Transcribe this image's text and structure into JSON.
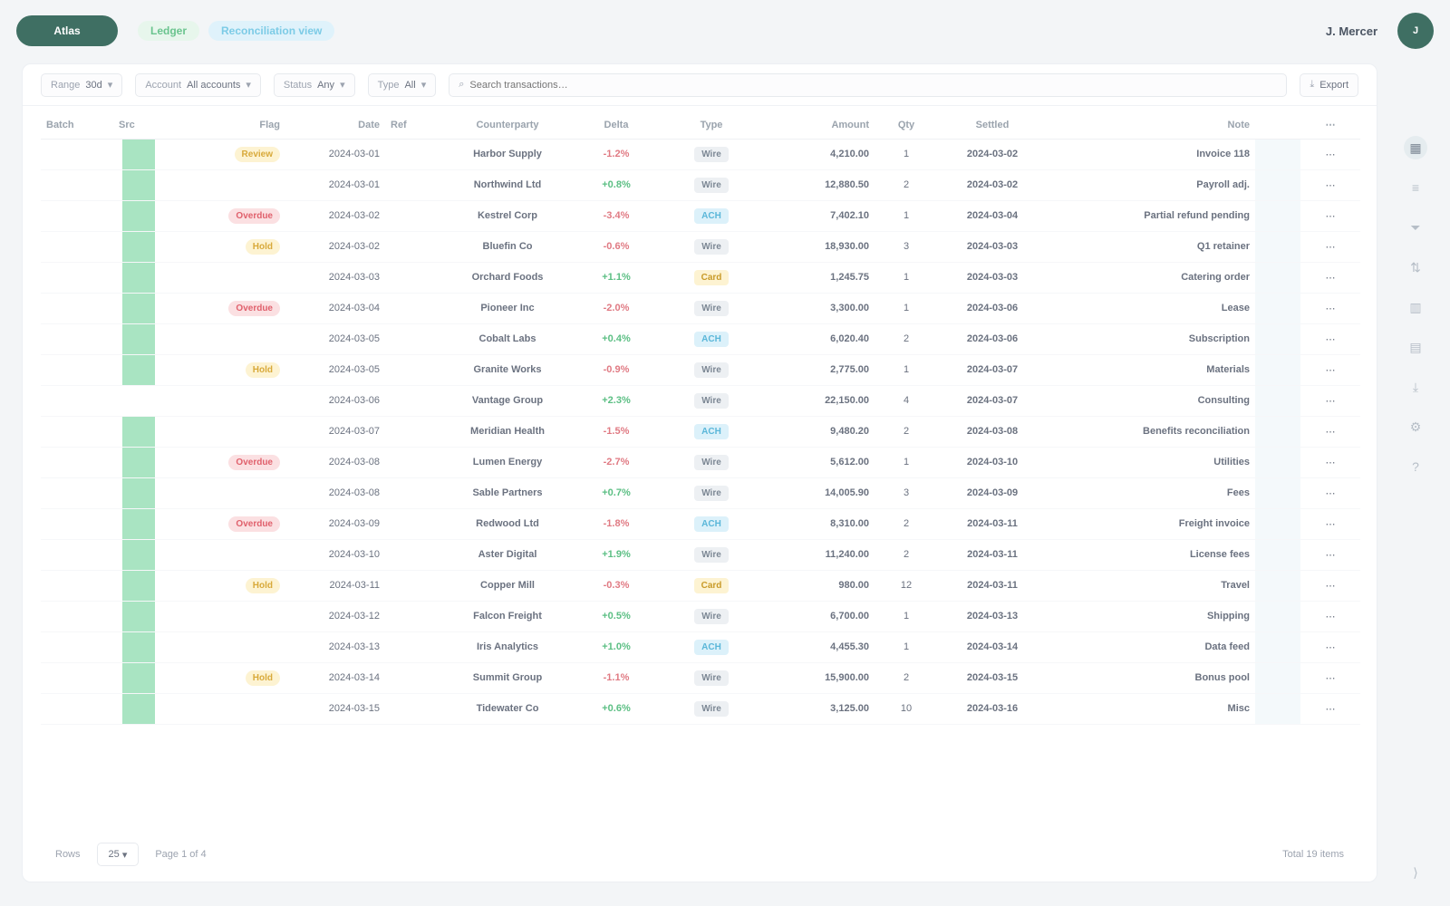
{
  "app": {
    "logo": "Atlas"
  },
  "breadcrumbs": [
    "Ledger",
    "Reconciliation view"
  ],
  "top": {
    "user": "J. Mercer",
    "avatar_initial": "J"
  },
  "filters": {
    "range_label": "Range",
    "range_value": "30d",
    "account_label": "Account",
    "account_value": "All accounts",
    "status_label": "Status",
    "status_value": "Any",
    "type_label": "Type",
    "type_value": "All",
    "search_placeholder": "Search transactions…",
    "export_label": "Export"
  },
  "table": {
    "columns": [
      "Batch",
      "Src",
      "Flag",
      "Date",
      "Ref",
      "Counterparty",
      "Delta",
      "Type",
      "Amount",
      "Qty",
      "Settled",
      "Note",
      "",
      "⋯"
    ],
    "rows": [
      {
        "flag": "Review",
        "flag_kind": "yellow",
        "date": "2024-03-01",
        "party": "Harbor Supply",
        "delta": "-1.2%",
        "delta_kind": "neg",
        "type": "Wire",
        "type_kind": "gray",
        "amount": "4,210.00",
        "qty": "1",
        "settled": "2024-03-02",
        "note": "Invoice 118"
      },
      {
        "flag": "",
        "flag_kind": "none",
        "date": "2024-03-01",
        "party": "Northwind Ltd",
        "delta": "+0.8%",
        "delta_kind": "pos",
        "type": "Wire",
        "type_kind": "gray",
        "amount": "12,880.50",
        "qty": "2",
        "settled": "2024-03-02",
        "note": "Payroll adj."
      },
      {
        "flag": "Overdue",
        "flag_kind": "red",
        "date": "2024-03-02",
        "party": "Kestrel Corp",
        "delta": "-3.4%",
        "delta_kind": "neg",
        "type": "ACH",
        "type_kind": "blue",
        "amount": "7,402.10",
        "qty": "1",
        "settled": "2024-03-04",
        "note": "Partial refund pending"
      },
      {
        "flag": "Hold",
        "flag_kind": "yellow",
        "date": "2024-03-02",
        "party": "Bluefin Co",
        "delta": "-0.6%",
        "delta_kind": "neg",
        "type": "Wire",
        "type_kind": "gray",
        "amount": "18,930.00",
        "qty": "3",
        "settled": "2024-03-03",
        "note": "Q1 retainer"
      },
      {
        "flag": "",
        "flag_kind": "none",
        "date": "2024-03-03",
        "party": "Orchard Foods",
        "delta": "+1.1%",
        "delta_kind": "pos",
        "type": "Card",
        "type_kind": "yellow",
        "amount": "1,245.75",
        "qty": "1",
        "settled": "2024-03-03",
        "note": "Catering order"
      },
      {
        "flag": "Overdue",
        "flag_kind": "red",
        "date": "2024-03-04",
        "party": "Pioneer Inc",
        "delta": "-2.0%",
        "delta_kind": "neg",
        "type": "Wire",
        "type_kind": "gray",
        "amount": "3,300.00",
        "qty": "1",
        "settled": "2024-03-06",
        "note": "Lease"
      },
      {
        "flag": "",
        "flag_kind": "none",
        "date": "2024-03-05",
        "party": "Cobalt Labs",
        "delta": "+0.4%",
        "delta_kind": "pos",
        "type": "ACH",
        "type_kind": "blue",
        "amount": "6,020.40",
        "qty": "2",
        "settled": "2024-03-06",
        "note": "Subscription"
      },
      {
        "flag": "Hold",
        "flag_kind": "yellow",
        "date": "2024-03-05",
        "party": "Granite Works",
        "delta": "-0.9%",
        "delta_kind": "neg",
        "type": "Wire",
        "type_kind": "gray",
        "amount": "2,775.00",
        "qty": "1",
        "settled": "2024-03-07",
        "note": "Materials"
      },
      {
        "flag": "",
        "flag_kind": "none",
        "date": "2024-03-06",
        "party": "Vantage Group",
        "delta": "+2.3%",
        "delta_kind": "pos",
        "type": "Wire",
        "type_kind": "gray",
        "amount": "22,150.00",
        "qty": "4",
        "settled": "2024-03-07",
        "note": "Consulting"
      },
      {
        "flag": "",
        "flag_kind": "none",
        "date": "2024-03-07",
        "party": "Meridian Health",
        "delta": "-1.5%",
        "delta_kind": "neg",
        "type": "ACH",
        "type_kind": "blue",
        "amount": "9,480.20",
        "qty": "2",
        "settled": "2024-03-08",
        "note": "Benefits reconciliation"
      },
      {
        "flag": "Overdue",
        "flag_kind": "red",
        "date": "2024-03-08",
        "party": "Lumen Energy",
        "delta": "-2.7%",
        "delta_kind": "neg",
        "type": "Wire",
        "type_kind": "gray",
        "amount": "5,612.00",
        "qty": "1",
        "settled": "2024-03-10",
        "note": "Utilities"
      },
      {
        "flag": "",
        "flag_kind": "none",
        "date": "2024-03-08",
        "party": "Sable Partners",
        "delta": "+0.7%",
        "delta_kind": "pos",
        "type": "Wire",
        "type_kind": "gray",
        "amount": "14,005.90",
        "qty": "3",
        "settled": "2024-03-09",
        "note": "Fees"
      },
      {
        "flag": "Overdue",
        "flag_kind": "red",
        "date": "2024-03-09",
        "party": "Redwood Ltd",
        "delta": "-1.8%",
        "delta_kind": "neg",
        "type": "ACH",
        "type_kind": "blue",
        "amount": "8,310.00",
        "qty": "2",
        "settled": "2024-03-11",
        "note": "Freight invoice"
      },
      {
        "flag": "",
        "flag_kind": "none",
        "date": "2024-03-10",
        "party": "Aster Digital",
        "delta": "+1.9%",
        "delta_kind": "pos",
        "type": "Wire",
        "type_kind": "gray",
        "amount": "11,240.00",
        "qty": "2",
        "settled": "2024-03-11",
        "note": "License fees"
      },
      {
        "flag": "Hold",
        "flag_kind": "yellow",
        "date": "2024-03-11",
        "party": "Copper Mill",
        "delta": "-0.3%",
        "delta_kind": "neg",
        "type": "Card",
        "type_kind": "yellow",
        "amount": "980.00",
        "qty": "12",
        "settled": "2024-03-11",
        "note": "Travel"
      },
      {
        "flag": "",
        "flag_kind": "none",
        "date": "2024-03-12",
        "party": "Falcon Freight",
        "delta": "+0.5%",
        "delta_kind": "pos",
        "type": "Wire",
        "type_kind": "gray",
        "amount": "6,700.00",
        "qty": "1",
        "settled": "2024-03-13",
        "note": "Shipping"
      },
      {
        "flag": "",
        "flag_kind": "none",
        "date": "2024-03-13",
        "party": "Iris Analytics",
        "delta": "+1.0%",
        "delta_kind": "pos",
        "type": "ACH",
        "type_kind": "blue",
        "amount": "4,455.30",
        "qty": "1",
        "settled": "2024-03-14",
        "note": "Data feed"
      },
      {
        "flag": "Hold",
        "flag_kind": "yellow",
        "date": "2024-03-14",
        "party": "Summit Group",
        "delta": "-1.1%",
        "delta_kind": "neg",
        "type": "Wire",
        "type_kind": "gray",
        "amount": "15,900.00",
        "qty": "2",
        "settled": "2024-03-15",
        "note": "Bonus pool"
      },
      {
        "flag": "",
        "flag_kind": "none",
        "date": "2024-03-15",
        "party": "Tidewater Co",
        "delta": "+0.6%",
        "delta_kind": "pos",
        "type": "Wire",
        "type_kind": "gray",
        "amount": "3,125.00",
        "qty": "10",
        "settled": "2024-03-16",
        "note": "Misc"
      }
    ]
  },
  "footer": {
    "rows_label": "Rows",
    "rows_value": "25",
    "page_info": "Page 1 of 4",
    "total": "Total 19 items"
  },
  "rail": {
    "icons": [
      "grid-icon",
      "list-icon",
      "filter-icon",
      "sort-icon",
      "columns-icon",
      "chart-icon",
      "download-icon",
      "settings-icon",
      "help-icon"
    ]
  }
}
